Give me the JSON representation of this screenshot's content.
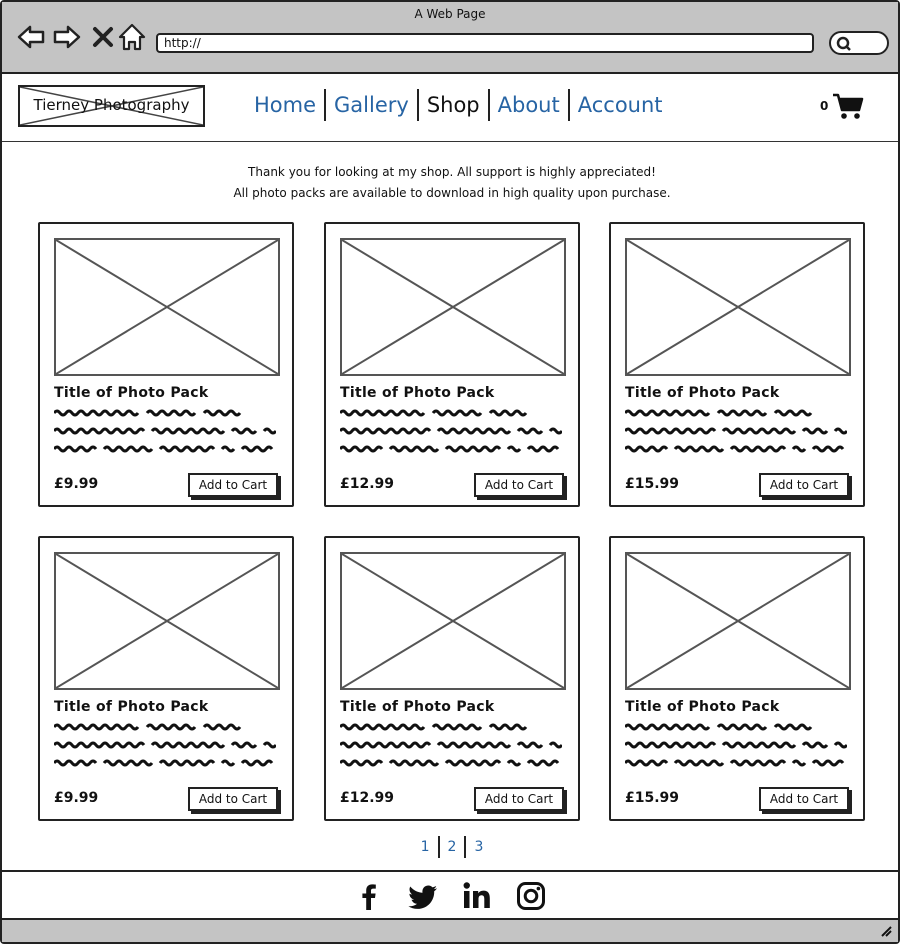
{
  "window": {
    "title": "A Web Page"
  },
  "browser": {
    "url": "http://",
    "icons": [
      "back-arrow-icon",
      "forward-arrow-icon",
      "close-x-icon",
      "home-icon",
      "search-icon"
    ]
  },
  "header": {
    "logo": "Tierney Photography",
    "nav": [
      {
        "label": "Home",
        "active": false
      },
      {
        "label": "Gallery",
        "active": false
      },
      {
        "label": "Shop",
        "active": true
      },
      {
        "label": "About",
        "active": false
      },
      {
        "label": "Account",
        "active": false
      }
    ],
    "cart_count": "0",
    "cart_icon": "shopping-cart-icon"
  },
  "intro": {
    "line1": "Thank you for looking at my shop. All support is highly appreciated!",
    "line2": "All photo packs are available to download in high quality upon purchase."
  },
  "products": [
    {
      "title": "Title of Photo Pack",
      "price": "£9.99",
      "button": "Add to Cart"
    },
    {
      "title": "Title of Photo Pack",
      "price": "£12.99",
      "button": "Add to Cart"
    },
    {
      "title": "Title of Photo Pack",
      "price": "£15.99",
      "button": "Add to Cart"
    },
    {
      "title": "Title of Photo Pack",
      "price": "£9.99",
      "button": "Add to Cart"
    },
    {
      "title": "Title of Photo Pack",
      "price": "£12.99",
      "button": "Add to Cart"
    },
    {
      "title": "Title of Photo Pack",
      "price": "£15.99",
      "button": "Add to Cart"
    }
  ],
  "pagination": [
    "1",
    "2",
    "3"
  ],
  "footer": {
    "social_icons": [
      "facebook-icon",
      "twitter-icon",
      "linkedin-icon",
      "instagram-icon"
    ]
  },
  "colors": {
    "link": "#2764a4",
    "chrome": "#c4c4c4",
    "border": "#222222"
  }
}
